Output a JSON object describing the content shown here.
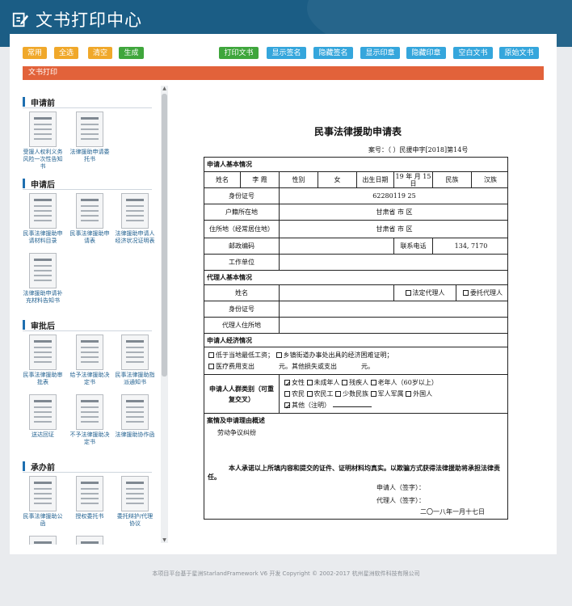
{
  "header": {
    "title": "文书打印中心",
    "icon": "edit-document-icon"
  },
  "toolbar": {
    "left_buttons": [
      "常用",
      "全选",
      "清空",
      "生成"
    ],
    "right_buttons": [
      "打印文书",
      "显示签名",
      "隐藏签名",
      "显示印章",
      "隐藏印章",
      "空白文书",
      "原始文书"
    ]
  },
  "tab": {
    "label": "文书打印"
  },
  "sections": [
    {
      "label": "申请前",
      "items": [
        "受援人权利义务风险一次性告知书",
        "法律援助申请委托书"
      ]
    },
    {
      "label": "申请后",
      "items": [
        "民事法律援助申请材料目录",
        "民事法律援助申请表",
        "法律援助申请人经济状况证明表",
        "法律援助申请补充材料告知书"
      ]
    },
    {
      "label": "审批后",
      "items": [
        "民事法律援助审批表",
        "给予法律援助决定书",
        "民事法律援助指派通知书",
        "送达回证",
        "不予法律援助决定书",
        "法律援助协作函"
      ]
    },
    {
      "label": "承办前",
      "items": [
        "民事法律援助公函",
        "授权委托书",
        "委托辩护/代理协议",
        "",
        ""
      ]
    }
  ],
  "document": {
    "title": "民事法律援助申请表",
    "case_no": "案号：（  ）民援申字[2018]第14号",
    "sec_applicant": "申请人基本情况",
    "name_label": "姓名",
    "name_value": "李   霞",
    "gender_label": "性别",
    "gender_value": "女",
    "birth_label": "出生日期",
    "birth_value": "19  年  月 15日",
    "ethnic_label": "民族",
    "ethnic_value": "汉族",
    "id_label": "身份证号",
    "id_value": "62280119        25",
    "hukou_label": "户籍所在地",
    "hukou_value": "甘肃省   市   区",
    "residence_label": "住所地（经常居住地）",
    "residence_value": "甘肃省   市   区",
    "zip_label": "邮政编码",
    "phone_label": "联系电话",
    "phone_value": "134,    7170",
    "work_label": "工作单位",
    "sec_agent": "代理人基本情况",
    "agent_name_label": "姓名",
    "legal_agent": "法定代理人",
    "entrusted_agent": "委托代理人",
    "agent_id_label": "身份证号",
    "agent_addr_label": "代理人住所地",
    "sec_economy": "申请人经济情况",
    "eco_opt1": "低于当地最低工资；",
    "eco_opt2": "乡镇街道办事处出具的经济困难证明；",
    "eco_opt3": "医疗费用支出",
    "eco_opt3_suffix": "元。其他损失或支出",
    "eco_opt3_unit": "元。",
    "sec_group": "申请人人群类别（可重复交叉）",
    "group_row1": [
      "女性",
      "未成年人",
      "残疾人",
      "老年人（60岁以上）"
    ],
    "group_row2": [
      "农民",
      "农民工",
      "少数民族",
      "军人军属",
      "外国人"
    ],
    "group_other": "其他（注明）",
    "group_checked": [
      "女性",
      "其他（注明）"
    ],
    "sec_reason": "案情及申请理由概述",
    "reason_text": "劳动争议纠纷",
    "pledge": "本人承诺以上所填内容和提交的证件、证明材料均真实。以欺骗方式获得法律援助将承担法律责任。",
    "sign_applicant": "申请人（签字）：",
    "sign_agent": "代理人（签字）：",
    "date": "二〇一八年一月十七日"
  },
  "footer": "本项目平台基于星洲StarlandFramework V6 开发      Copyright © 2002-2017 杭州星洲软件科技有限公司"
}
